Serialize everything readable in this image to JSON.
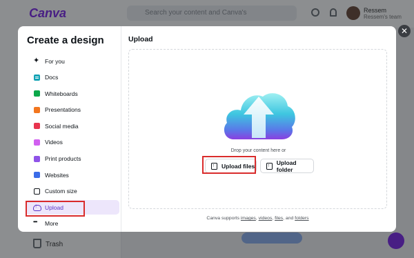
{
  "background": {
    "logo": "Canva",
    "search_placeholder": "Search your content and Canva's",
    "user_name": "Ressem",
    "user_sub": "Ressem's team",
    "trash_label": "Trash"
  },
  "modal": {
    "title": "Create a design",
    "nav_items": [
      {
        "label": "For you",
        "icon": "sparkle-icon"
      },
      {
        "label": "Docs",
        "icon": "docs-icon"
      },
      {
        "label": "Whiteboards",
        "icon": "whiteboard-icon"
      },
      {
        "label": "Presentations",
        "icon": "presentation-icon"
      },
      {
        "label": "Social media",
        "icon": "social-media-icon"
      },
      {
        "label": "Videos",
        "icon": "video-icon"
      },
      {
        "label": "Print products",
        "icon": "print-icon"
      },
      {
        "label": "Websites",
        "icon": "website-icon"
      },
      {
        "label": "Custom size",
        "icon": "custom-size-icon"
      },
      {
        "label": "Upload",
        "icon": "upload-icon",
        "active": true
      },
      {
        "label": "More",
        "icon": "more-icon"
      }
    ],
    "content": {
      "title": "Upload",
      "drop_text": "Drop your content here or",
      "upload_files_label": "Upload files",
      "upload_folder_label": "Upload folder",
      "supports_prefix": "Canva supports ",
      "supports_images": "images",
      "supports_sep1": ", ",
      "supports_videos": "videos",
      "supports_sep2": ", ",
      "supports_files": "files",
      "supports_sep3": ", and ",
      "supports_folders": "folders"
    },
    "close_symbol": "✕"
  },
  "colors": {
    "accent": "#7d2ae8",
    "active_bg": "#ede6fb",
    "highlight": "#d92b2b"
  }
}
